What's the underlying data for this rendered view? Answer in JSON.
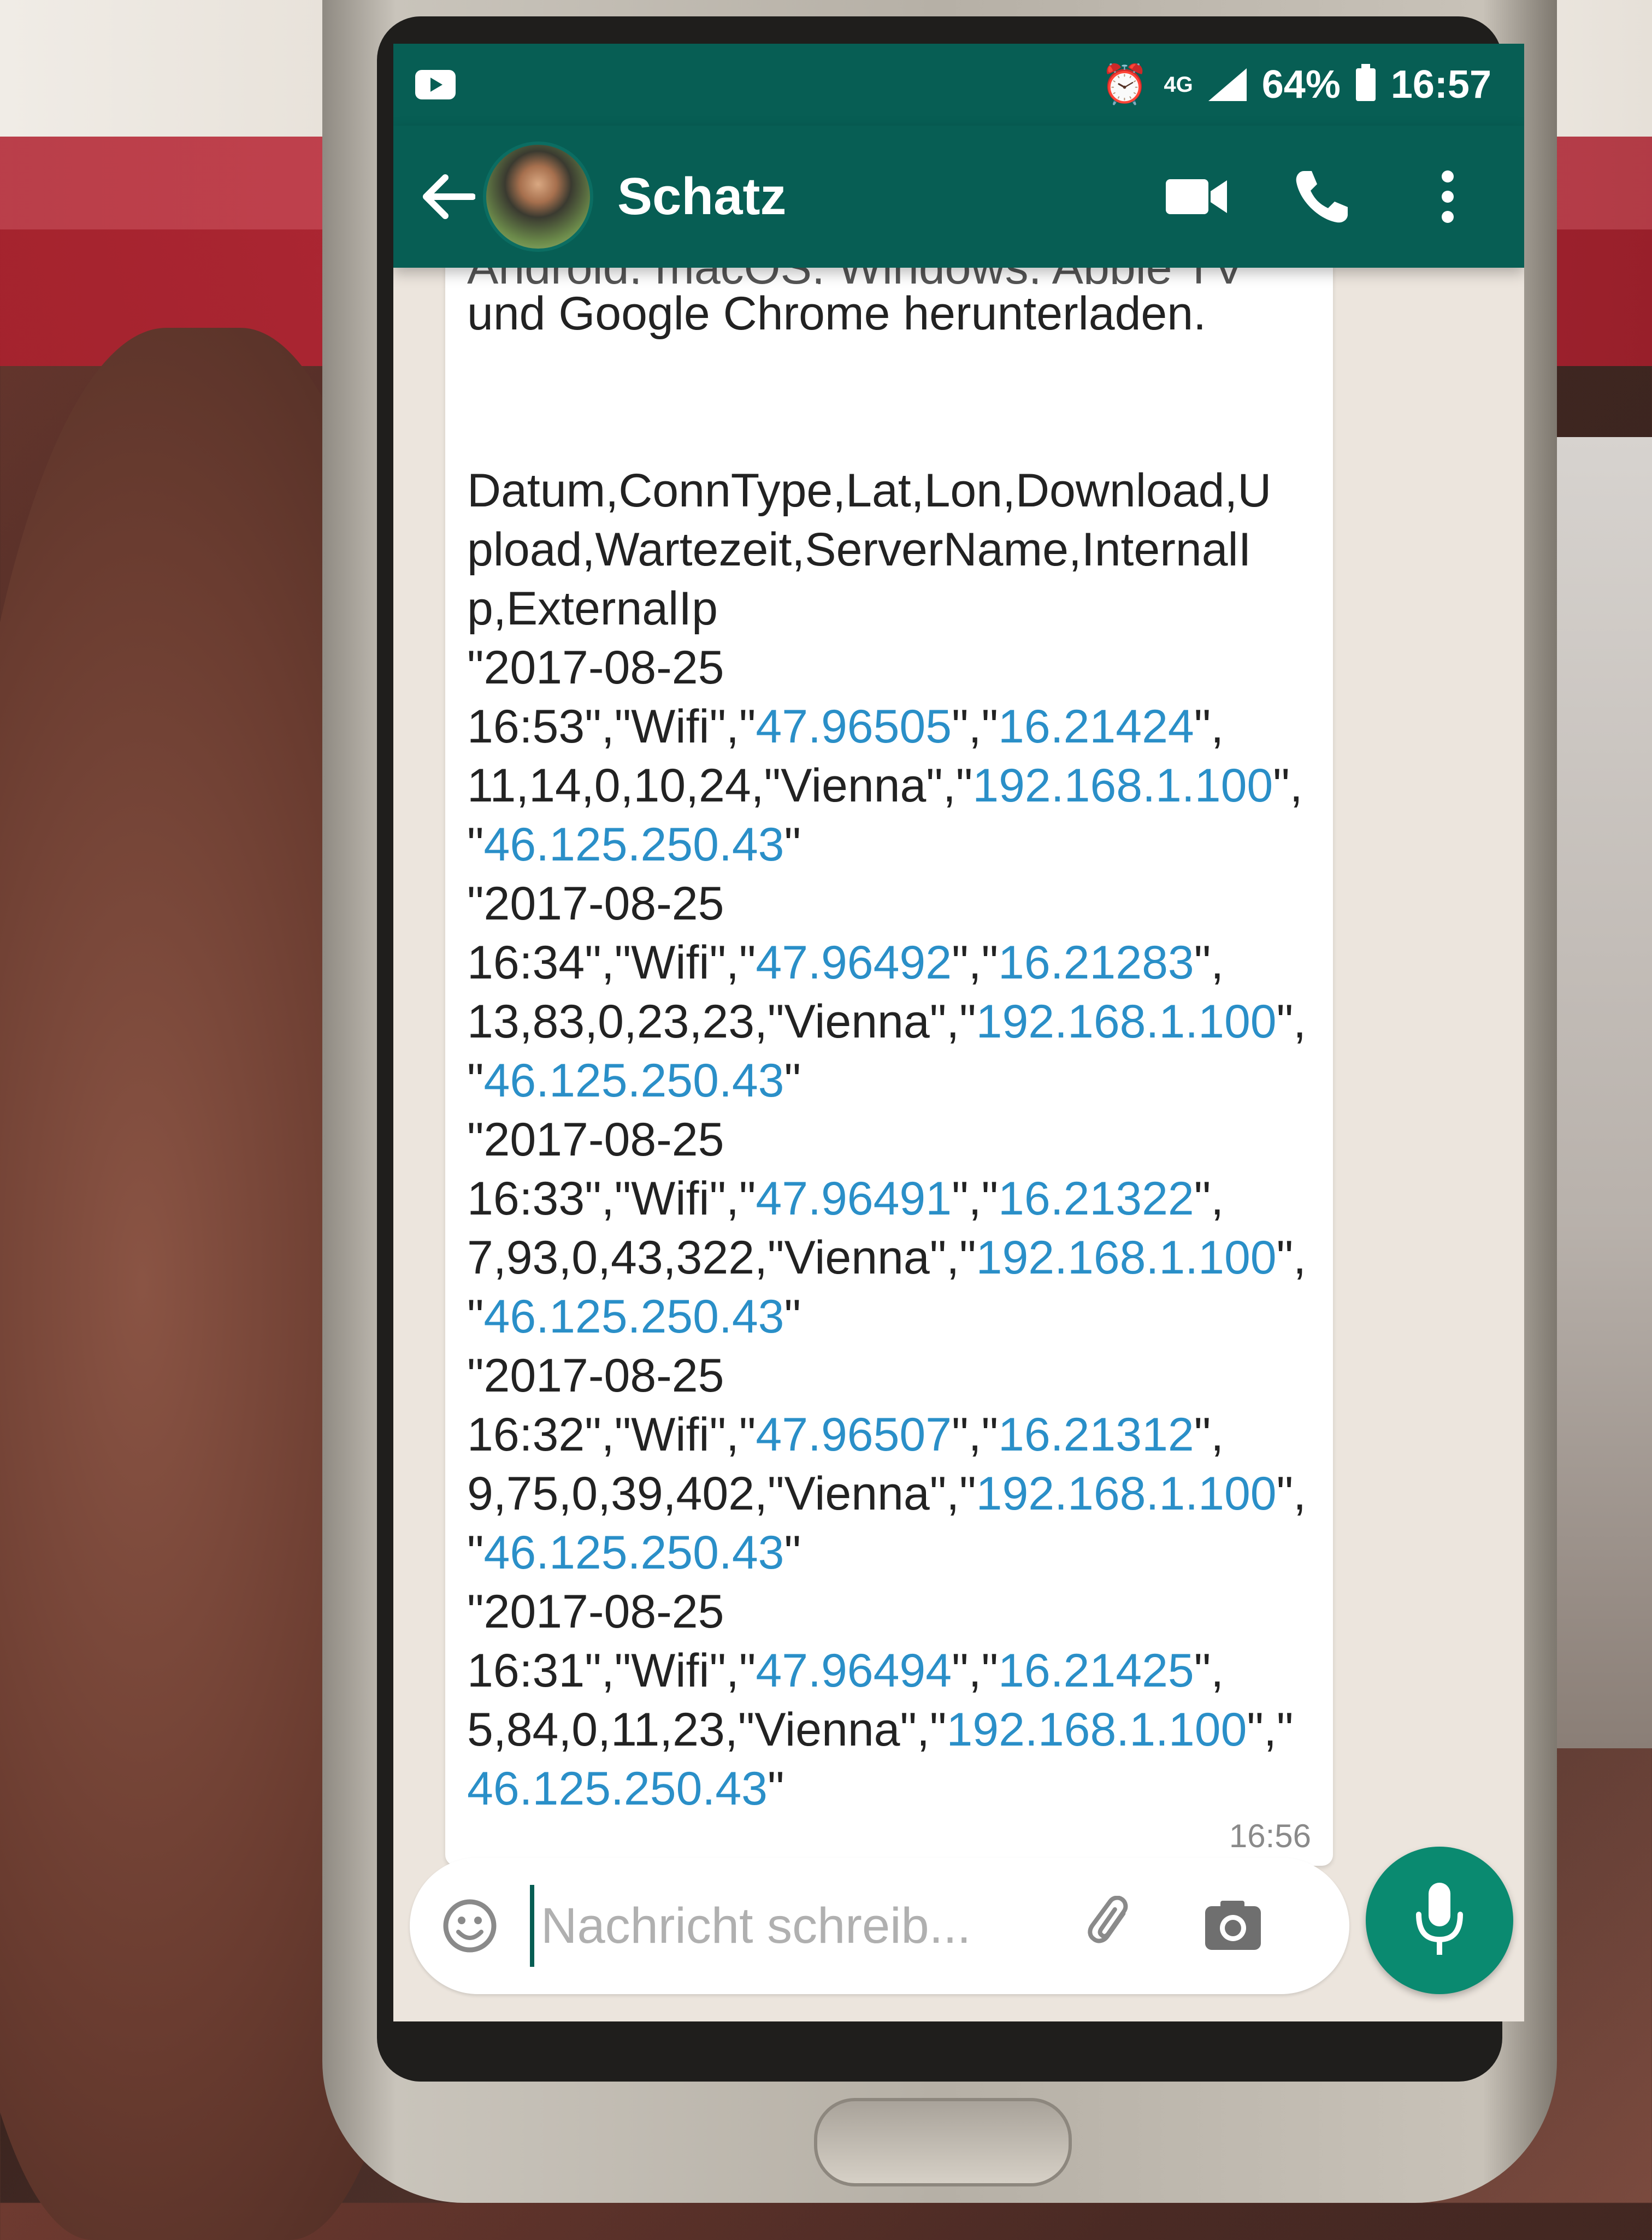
{
  "status_bar": {
    "network": "4G",
    "battery": "64%",
    "time": "16:57"
  },
  "header": {
    "contact_name": "Schatz"
  },
  "message": {
    "lines": [
      "Android, macOS, Windows, Apple TV",
      "und Google Chrome herunterladen.",
      "",
      "Datum,ConnType,Lat,Lon,Download,U",
      "pload,Wartezeit,ServerName,InternalI",
      "p,ExternalIp"
    ],
    "rows": [
      {
        "date": "\"2017-08-25",
        "time_prefix": "16:53\",\"Wifi\",\"",
        "lat": "47.96505",
        "sep": "\",\"",
        "lon": "16.21424",
        "lon_suffix": "\",",
        "values_prefix": "11,14,0,10,24,\"Vienna\",\"",
        "internal_ip": "192.168.1.100",
        "ip_suffix": "\",",
        "external_open": "\"",
        "external_ip": "46.125.250.43",
        "external_close": "\""
      },
      {
        "date": "\"2017-08-25",
        "time_prefix": "16:34\",\"Wifi\",\"",
        "lat": "47.96492",
        "sep": "\",\"",
        "lon": "16.21283",
        "lon_suffix": "\",",
        "values_prefix": "13,83,0,23,23,\"Vienna\",\"",
        "internal_ip": "192.168.1.100",
        "ip_suffix": "\",",
        "external_open": "\"",
        "external_ip": "46.125.250.43",
        "external_close": "\""
      },
      {
        "date": "\"2017-08-25",
        "time_prefix": "16:33\",\"Wifi\",\"",
        "lat": "47.96491",
        "sep": "\",\"",
        "lon": "16.21322",
        "lon_suffix": "\",",
        "values_prefix": "7,93,0,43,322,\"Vienna\",\"",
        "internal_ip": "192.168.1.100",
        "ip_suffix": "\",",
        "external_open": "\"",
        "external_ip": "46.125.250.43",
        "external_close": "\""
      },
      {
        "date": "\"2017-08-25",
        "time_prefix": "16:32\",\"Wifi\",\"",
        "lat": "47.96507",
        "sep": "\",\"",
        "lon": "16.21312",
        "lon_suffix": "\",",
        "values_prefix": "9,75,0,39,402,\"Vienna\",\"",
        "internal_ip": "192.168.1.100",
        "ip_suffix": "\",",
        "external_open": "\"",
        "external_ip": "46.125.250.43",
        "external_close": "\""
      },
      {
        "date": "\"2017-08-25",
        "time_prefix": "16:31\",\"Wifi\",\"",
        "lat": "47.96494",
        "sep": "\",\"",
        "lon": "16.21425",
        "lon_suffix": "\",",
        "values_prefix": "5,84,0,11,23,\"Vienna\",\"",
        "internal_ip": "192.168.1.100",
        "ip_suffix": "\",\"",
        "external_open": "",
        "external_ip": "46.125.250.43",
        "external_close": "\""
      }
    ],
    "timestamp": "16:56"
  },
  "composer": {
    "placeholder": "Nachricht schreib..."
  },
  "icons": {
    "back": "arrow-left-icon",
    "video": "video-call-icon",
    "call": "phone-icon",
    "menu": "more-vert-icon",
    "emoji": "emoji-icon",
    "attach": "paperclip-icon",
    "camera": "camera-icon",
    "mic": "mic-icon"
  },
  "colors": {
    "brand": "#075e54",
    "accent": "#0a8a70",
    "link": "#2a8fc8",
    "chat_bg": "#ece5dd"
  }
}
